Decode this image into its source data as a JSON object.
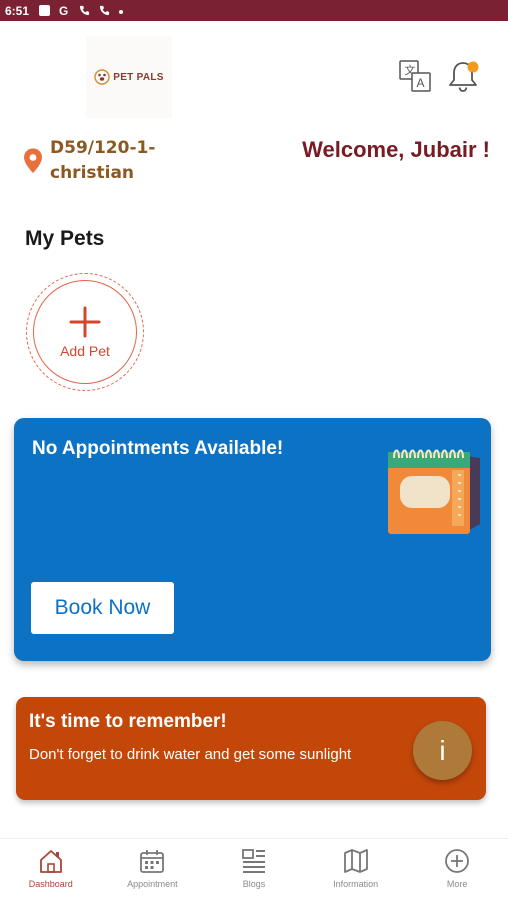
{
  "status_bar": {
    "time": "6:51"
  },
  "header": {
    "logo_text": "PET PALS",
    "brand_color": "#8b3a2e",
    "translate_icon": "translate-icon",
    "bell_icon": "bell-icon",
    "notification_dot_color": "#f39a1c"
  },
  "location": {
    "address": "D59/120-1-christian"
  },
  "welcome_text": "Welcome, Jubair !",
  "my_pets": {
    "title": "My Pets",
    "add_pet_label": "Add Pet"
  },
  "appointment_card": {
    "title": "No Appointments Available!",
    "button_label": "Book Now",
    "background": "#0b72c4"
  },
  "reminder_card": {
    "title": "It's time to remember!",
    "text": "Don't forget to drink water and get some sunlight",
    "info_label": "i",
    "background": "#c4470a"
  },
  "bottom_nav": {
    "items": [
      {
        "label": "Dashboard",
        "icon": "home-icon",
        "active": true
      },
      {
        "label": "Appointment",
        "icon": "calendar-icon",
        "active": false
      },
      {
        "label": "Blogs",
        "icon": "blogs-icon",
        "active": false
      },
      {
        "label": "Information",
        "icon": "map-icon",
        "active": false
      },
      {
        "label": "More",
        "icon": "plus-circle-icon",
        "active": false
      }
    ]
  }
}
